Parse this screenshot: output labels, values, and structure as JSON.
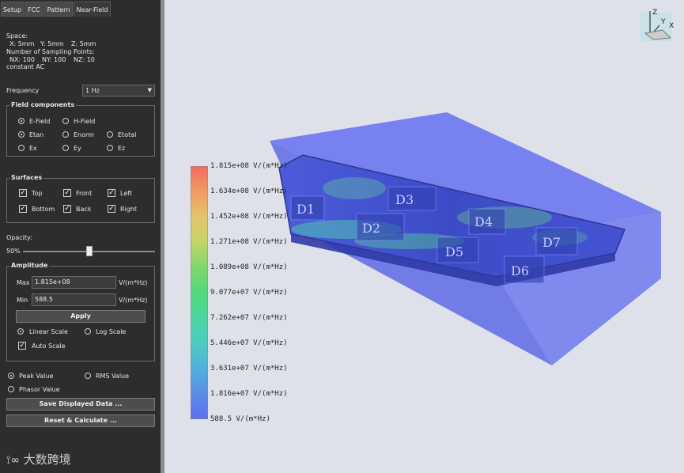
{
  "tabs": [
    "Setup",
    "FCC",
    "Pattern",
    "Near-Field"
  ],
  "info": {
    "space_label": "Space:",
    "space_x": "X: 5mm",
    "space_y": "Y: 5mm",
    "space_z": "Z: 5mm",
    "sampling_label": "Number of Sampling Points:",
    "nx": "NX: 100",
    "ny": "NY: 100",
    "nz": "NZ: 10",
    "mode": "constant AC"
  },
  "frequency": {
    "label": "Frequency",
    "value": "1 Hz"
  },
  "field_components": {
    "title": "Field components",
    "options": [
      "E-Field",
      "H-Field",
      "Etan",
      "Enorm",
      "Etotal",
      "Ex",
      "Ey",
      "Ez"
    ]
  },
  "surfaces": {
    "title": "Surfaces",
    "items": [
      "Top",
      "Front",
      "Left",
      "Bottom",
      "Back",
      "Right"
    ]
  },
  "opacity": {
    "label": "Opacity:",
    "value": "50%",
    "fraction": 0.5
  },
  "amplitude": {
    "title": "Amplitude",
    "max_label": "Max",
    "max_value": "1.815e+08",
    "min_label": "Min",
    "min_value": "588.5",
    "unit": "V/(m*Hz)",
    "apply": "Apply",
    "linear": "Linear Scale",
    "log": "Log Scale",
    "auto": "Auto Scale"
  },
  "value_type": {
    "peak": "Peak Value",
    "rms": "RMS Value",
    "phasor": "Phasor Value"
  },
  "buttons": {
    "save": "Save Displayed Data ...",
    "reset": "Reset & Calculate ..."
  },
  "watermark": "大数跨境",
  "legend": [
    "1.815e+08 V/(m*Hz)",
    "1.634e+08 V/(m*Hz)",
    "1.452e+08 V/(m*Hz)",
    "1.271e+08 V/(m*Hz)",
    "1.089e+08 V/(m*Hz)",
    "9.077e+07 V/(m*Hz)",
    "7.262e+07 V/(m*Hz)",
    "5.446e+07 V/(m*Hz)",
    "3.631e+07 V/(m*Hz)",
    "1.816e+07 V/(m*Hz)",
    "588.5 V/(m*Hz)"
  ],
  "components": [
    "D1",
    "D2",
    "D3",
    "D4",
    "D5",
    "D6",
    "D7"
  ],
  "axes": {
    "x": "X",
    "y": "Y",
    "z": "Z"
  },
  "colors": {
    "panel_bg": "#2d2d2d",
    "viewport_bg": "#dfe1ea",
    "field_blue": "#5a68e6"
  }
}
